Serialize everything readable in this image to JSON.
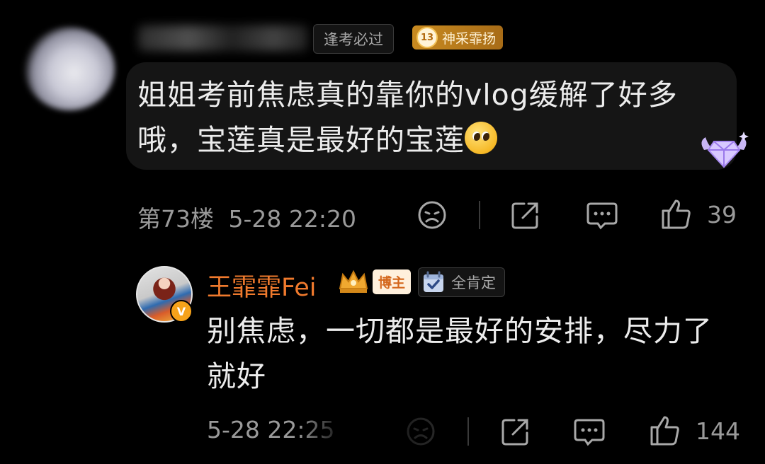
{
  "comment": {
    "username_hidden": true,
    "tag_label": "逢考必过",
    "honor_level": "13",
    "honor_label": "神采霏扬",
    "text": "姐姐考前焦虑真的靠你的vlog缓解了好多哦，宝莲真是最好的宝莲",
    "emoji": "pleading-face",
    "floor": "第73楼",
    "time": "5-28 22:20",
    "likes": "39"
  },
  "reply": {
    "author": "王霏霏Fei",
    "host_label": "博主",
    "fan_tag": "全肯定",
    "verified_badge": "V",
    "text": "别焦虑，一切都是最好的安排，尽力了就好",
    "time": "5-28 22:25",
    "likes": "144"
  },
  "colors": {
    "background": "#000000",
    "author_name": "#f07a2d",
    "honor_tag": "#c88a20",
    "meta_text": "#9a9a9a"
  },
  "icons": [
    "dislike-face-icon",
    "share-icon",
    "comment-icon",
    "like-icon",
    "gem-badge-icon",
    "crown-icon",
    "calendar-check-icon"
  ]
}
